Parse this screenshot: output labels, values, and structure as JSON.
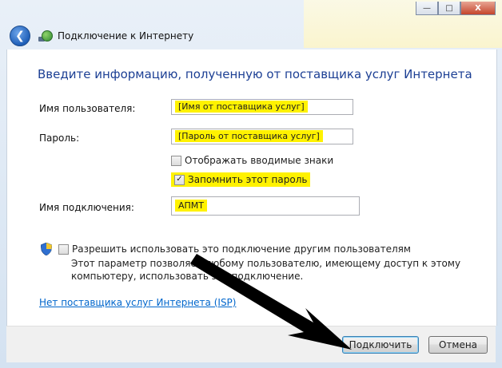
{
  "window": {
    "title": "Подключение к Интернету",
    "caption_buttons": {
      "minimize": "—",
      "maximize": "□",
      "close": "X"
    }
  },
  "heading": "Введите информацию, полученную от поставщика услуг Интернета",
  "fields": {
    "username": {
      "label": "Имя пользователя:",
      "value": "[Имя от поставщика услуг]"
    },
    "password": {
      "label": "Пароль:",
      "value": "[Пароль от поставщика услуг]"
    },
    "show_chars": {
      "label": "Отображать вводимые знаки",
      "checked": false
    },
    "remember_password": {
      "label": "Запомнить этот пароль",
      "checked": true
    },
    "connection_name": {
      "label": "Имя подключения:",
      "value": "АПМТ"
    }
  },
  "share": {
    "label": "Разрешить использовать это подключение другим пользователям",
    "checked": false,
    "description": "Этот параметр позволяет любому пользователю, имеющему доступ к этому компьютеру, использовать это подключение."
  },
  "isp_link": "Нет поставщика услуг Интернета (ISP)",
  "buttons": {
    "connect": "Подключить",
    "cancel": "Отмена"
  },
  "icons": {
    "back": "back-arrow-icon",
    "network": "network-globe-icon",
    "shield": "uac-shield-icon",
    "check": "checkmark-icon"
  },
  "colors": {
    "highlight": "#fff200",
    "heading": "#1c3f94",
    "link": "#0066cc"
  }
}
